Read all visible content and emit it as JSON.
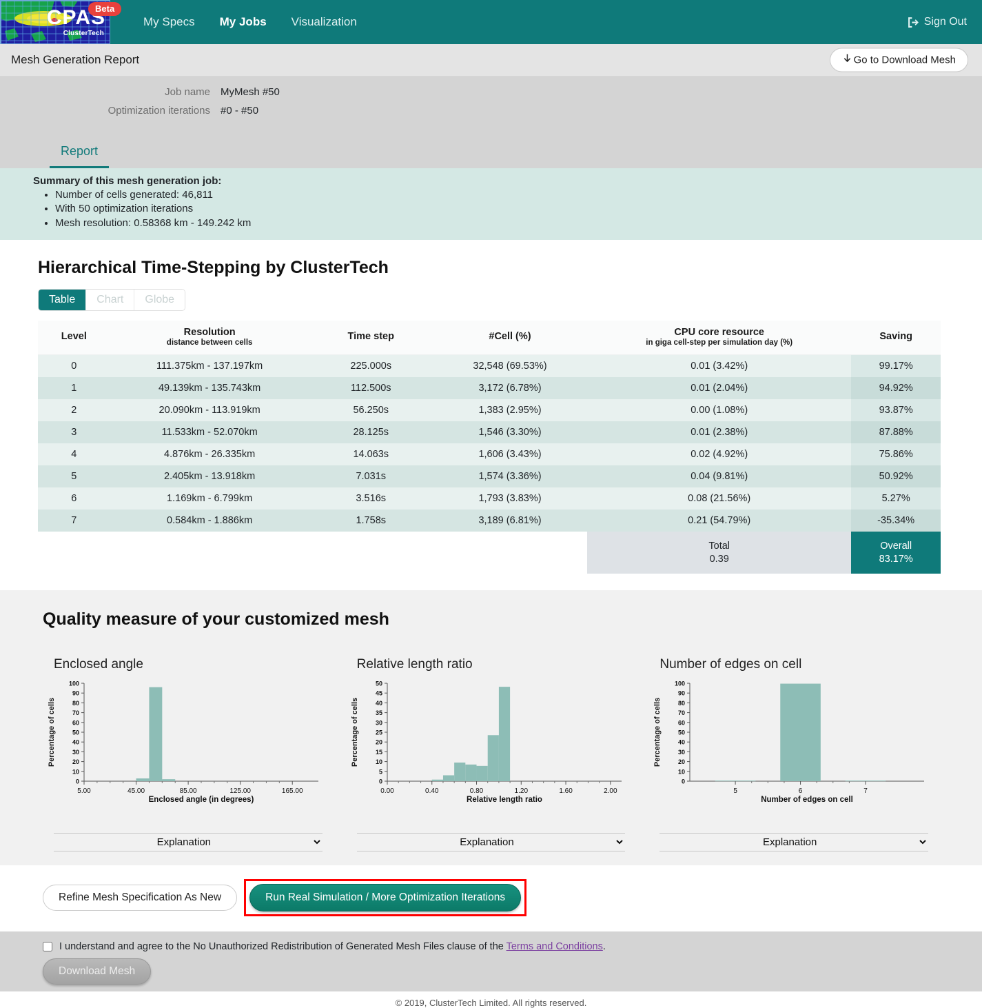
{
  "navbar": {
    "logo_text": "CPAS",
    "logo_sub": "ClusterTech",
    "beta_label": "Beta",
    "links": [
      {
        "label": "My Specs",
        "active": false
      },
      {
        "label": "My Jobs",
        "active": true
      },
      {
        "label": "Visualization",
        "active": false
      }
    ],
    "signout_label": "Sign Out",
    "bg_color": "#0f7a7a"
  },
  "titlebar": {
    "title": "Mesh Generation Report",
    "download_top_label": "Go to Download Mesh"
  },
  "meta": {
    "job_name_label": "Job name",
    "job_name_value": "MyMesh #50",
    "iterations_label": "Optimization iterations",
    "iterations_value": "#0 - #50",
    "tab_report": "Report"
  },
  "summary": {
    "title": "Summary of this mesh generation job:",
    "items": [
      "Number of cells generated: 46,811",
      "With 50 optimization iterations",
      "Mesh resolution: 0.58368 km - 149.242 km"
    ]
  },
  "hts": {
    "heading": "Hierarchical Time-Stepping by ClusterTech",
    "view_buttons": [
      {
        "label": "Table",
        "active": true
      },
      {
        "label": "Chart",
        "active": false
      },
      {
        "label": "Globe",
        "active": false
      }
    ],
    "columns": [
      {
        "label": "Level",
        "sub": ""
      },
      {
        "label": "Resolution",
        "sub": "distance between cells"
      },
      {
        "label": "Time step",
        "sub": ""
      },
      {
        "label": "#Cell (%)",
        "sub": ""
      },
      {
        "label": "CPU core resource",
        "sub": "in giga cell-step per simulation day (%)"
      },
      {
        "label": "Saving",
        "sub": ""
      }
    ],
    "rows": [
      {
        "level": "0",
        "resolution": "111.375km - 137.197km",
        "time_step": "225.000s",
        "cell": "32,548 (69.53%)",
        "cpu": "0.01 (3.42%)",
        "saving": "99.17%"
      },
      {
        "level": "1",
        "resolution": "49.139km - 135.743km",
        "time_step": "112.500s",
        "cell": "3,172 (6.78%)",
        "cpu": "0.01 (2.04%)",
        "saving": "94.92%"
      },
      {
        "level": "2",
        "resolution": "20.090km - 113.919km",
        "time_step": "56.250s",
        "cell": "1,383 (2.95%)",
        "cpu": "0.00 (1.08%)",
        "saving": "93.87%"
      },
      {
        "level": "3",
        "resolution": "11.533km - 52.070km",
        "time_step": "28.125s",
        "cell": "1,546 (3.30%)",
        "cpu": "0.01 (2.38%)",
        "saving": "87.88%"
      },
      {
        "level": "4",
        "resolution": "4.876km - 26.335km",
        "time_step": "14.063s",
        "cell": "1,606 (3.43%)",
        "cpu": "0.02 (4.92%)",
        "saving": "75.86%"
      },
      {
        "level": "5",
        "resolution": "2.405km - 13.918km",
        "time_step": "7.031s",
        "cell": "1,574 (3.36%)",
        "cpu": "0.04 (9.81%)",
        "saving": "50.92%"
      },
      {
        "level": "6",
        "resolution": "1.169km - 6.799km",
        "time_step": "3.516s",
        "cell": "1,793 (3.83%)",
        "cpu": "0.08 (21.56%)",
        "saving": "5.27%"
      },
      {
        "level": "7",
        "resolution": "0.584km - 1.886km",
        "time_step": "1.758s",
        "cell": "3,189 (6.81%)",
        "cpu": "0.21 (54.79%)",
        "saving": "-35.34%"
      }
    ],
    "total_label": "Total",
    "total_value": "0.39",
    "overall_label": "Overall",
    "overall_value": "83.17%"
  },
  "quality": {
    "heading": "Quality measure of your customized mesh",
    "explanation_option": "Explanation"
  },
  "chart_data": [
    {
      "type": "bar",
      "title": "Enclosed angle",
      "xlabel": "Enclosed angle (in degrees)",
      "ylabel": "Percentage of cells",
      "xlim": [
        5.0,
        185.0
      ],
      "ylim": [
        0,
        100
      ],
      "xticks": [
        "5.00",
        "45.00",
        "85.00",
        "125.00",
        "165.00"
      ],
      "xtick_values": [
        5,
        45,
        85,
        125,
        165
      ],
      "yticks": [
        0,
        10,
        20,
        30,
        40,
        50,
        60,
        70,
        80,
        90,
        100
      ],
      "bin_width": 10,
      "bins": [
        {
          "x0": 45,
          "x1": 55,
          "value": 2.8
        },
        {
          "x0": 55,
          "x1": 65,
          "value": 96.0
        },
        {
          "x0": 65,
          "x1": 75,
          "value": 2.0
        }
      ],
      "bar_color": "#8dbdb6",
      "grid": false,
      "legend": "none"
    },
    {
      "type": "bar",
      "title": "Relative length ratio",
      "xlabel": "Relative length ratio",
      "ylabel": "Percentage of cells",
      "xlim": [
        0.0,
        2.1
      ],
      "ylim": [
        0,
        50
      ],
      "xticks": [
        "0.00",
        "0.40",
        "0.80",
        "1.20",
        "1.60",
        "2.00"
      ],
      "xtick_values": [
        0.0,
        0.4,
        0.8,
        1.2,
        1.6,
        2.0
      ],
      "yticks": [
        0,
        5,
        10,
        15,
        20,
        25,
        30,
        35,
        40,
        45,
        50
      ],
      "bin_width": 0.1,
      "bins": [
        {
          "x0": 0.4,
          "x1": 0.5,
          "value": 0.8
        },
        {
          "x0": 0.5,
          "x1": 0.6,
          "value": 3.0
        },
        {
          "x0": 0.6,
          "x1": 0.7,
          "value": 9.5
        },
        {
          "x0": 0.7,
          "x1": 0.8,
          "value": 8.5
        },
        {
          "x0": 0.8,
          "x1": 0.9,
          "value": 7.8
        },
        {
          "x0": 0.9,
          "x1": 1.0,
          "value": 23.5
        },
        {
          "x0": 1.0,
          "x1": 1.1,
          "value": 48.2
        }
      ],
      "bar_color": "#8dbdb6",
      "grid": false,
      "legend": "none"
    },
    {
      "type": "bar",
      "title": "Number of edges on cell",
      "xlabel": "Number of edges on cell",
      "ylabel": "Percentage of cells",
      "xlim": [
        4.3,
        7.9
      ],
      "ylim": [
        0,
        100
      ],
      "xticks": [
        "5",
        "6",
        "7"
      ],
      "xtick_values": [
        5,
        6,
        7
      ],
      "yticks": [
        0,
        10,
        20,
        30,
        40,
        50,
        60,
        70,
        80,
        90,
        100
      ],
      "categories": [
        5,
        6,
        7
      ],
      "values": [
        0.6,
        99.6,
        0.6
      ],
      "bar_color": "#8dbdb6",
      "grid": false,
      "legend": "none"
    }
  ],
  "actions": {
    "refine_label": "Refine Mesh Specification As New",
    "run_label": "Run Real Simulation / More Optimization Iterations",
    "highlight_color": "#ff0000"
  },
  "footer": {
    "agree_text_before": "I understand and agree to the No Unauthorized Redistribution of Generated Mesh Files clause of the ",
    "agree_link": "Terms and Conditions",
    "agree_text_after": ".",
    "download_label": "Download Mesh",
    "copyright": "© 2019, ClusterTech Limited. All rights reserved."
  }
}
